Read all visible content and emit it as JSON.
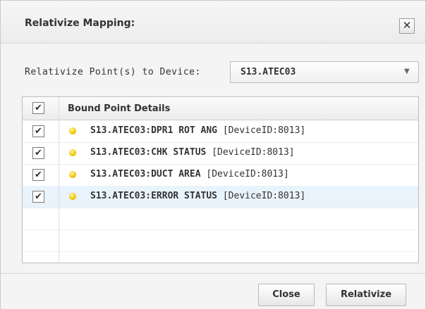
{
  "dialog": {
    "title": "Relativize Mapping:",
    "close_glyph": "✕"
  },
  "device": {
    "label": "Relativize Point(s) to Device:",
    "selected": "S13.ATEC03",
    "arrow_icon": "▼"
  },
  "grid": {
    "header_check": "✔",
    "header": "Bound Point Details",
    "rows": [
      {
        "checked": true,
        "point": "S13.ATEC03:DPR1 ROT ANG",
        "device": "[DeviceID:8013]",
        "status_color": "#f2c200"
      },
      {
        "checked": true,
        "point": "S13.ATEC03:CHK STATUS",
        "device": "[DeviceID:8013]",
        "status_color": "#f2c200"
      },
      {
        "checked": true,
        "point": "S13.ATEC03:DUCT AREA",
        "device": "[DeviceID:8013]",
        "status_color": "#f2c200"
      },
      {
        "checked": true,
        "point": "S13.ATEC03:ERROR STATUS",
        "device": "[DeviceID:8013]",
        "status_color": "#f2c200"
      }
    ],
    "check_glyph": "✔"
  },
  "footer": {
    "close_label": "Close",
    "relativize_label": "Relativize"
  }
}
